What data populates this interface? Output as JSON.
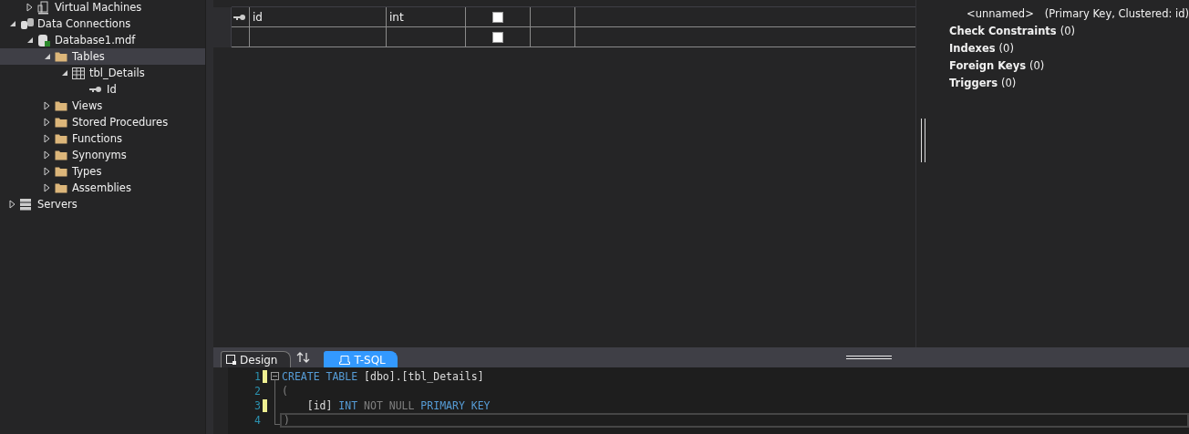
{
  "tree": {
    "scrolled_parent_children": [
      {
        "label": "Virtual Machines",
        "kind": "vm",
        "expanded": false,
        "selected": false
      }
    ],
    "nodes": [
      {
        "label": "Data Connections",
        "kind": "connections",
        "expanded": true,
        "selected": false,
        "children": [
          {
            "label": "Database1.mdf",
            "kind": "database",
            "expanded": true,
            "selected": false,
            "children": [
              {
                "label": "Tables",
                "kind": "folder",
                "expanded": true,
                "selected": true,
                "children": [
                  {
                    "label": "tbl_Details",
                    "kind": "table",
                    "expanded": true,
                    "selected": false,
                    "children": [
                      {
                        "label": "Id",
                        "kind": "key",
                        "selected": false
                      }
                    ]
                  }
                ]
              },
              {
                "label": "Views",
                "kind": "folder",
                "expanded": false,
                "selected": false
              },
              {
                "label": "Stored Procedures",
                "kind": "folder",
                "expanded": false,
                "selected": false
              },
              {
                "label": "Functions",
                "kind": "folder",
                "expanded": false,
                "selected": false
              },
              {
                "label": "Synonyms",
                "kind": "folder",
                "expanded": false,
                "selected": false
              },
              {
                "label": "Types",
                "kind": "folder",
                "expanded": false,
                "selected": false
              },
              {
                "label": "Assemblies",
                "kind": "folder",
                "expanded": false,
                "selected": false
              }
            ]
          }
        ]
      },
      {
        "label": "Servers",
        "kind": "server",
        "expanded": false,
        "selected": false
      }
    ]
  },
  "grid": {
    "rows": [
      {
        "primary_key": true,
        "name": "id",
        "type": "int",
        "allow_nulls": false
      },
      {
        "primary_key": false,
        "allow_nulls": false
      }
    ]
  },
  "properties": [
    {
      "kind": "key",
      "label": "<unnamed>",
      "detail": "(Primary Key, Clustered: id)"
    },
    {
      "kind": "group",
      "label": "Check Constraints",
      "detail": "(0)"
    },
    {
      "kind": "group",
      "label": "Indexes",
      "detail": "(0)"
    },
    {
      "kind": "group",
      "label": "Foreign Keys",
      "detail": "(0)"
    },
    {
      "kind": "group",
      "label": "Triggers",
      "detail": "(0)"
    }
  ],
  "tabs": [
    {
      "label": "Design",
      "kind": "design",
      "selected": false
    },
    {
      "label": "T-SQL",
      "kind": "tsql",
      "selected": true
    }
  ],
  "code": [
    {
      "number": "1",
      "changed": true,
      "current": false,
      "tokens": [
        {
          "kind": "keyword",
          "text": "CREATE TABLE "
        },
        {
          "kind": "plain",
          "text": "[dbo].[tbl_Details]"
        }
      ]
    },
    {
      "number": "2",
      "changed": false,
      "current": false,
      "tokens": [
        {
          "kind": "grey",
          "text": "("
        }
      ]
    },
    {
      "number": "3",
      "changed": true,
      "current": false,
      "tokens": [
        {
          "kind": "plain",
          "text": "    [id] "
        },
        {
          "kind": "keyword",
          "text": "INT "
        },
        {
          "kind": "grey",
          "text": "NOT NULL "
        },
        {
          "kind": "keyword",
          "text": "PRIMARY KEY"
        }
      ]
    },
    {
      "number": "4",
      "changed": false,
      "current": true,
      "tokens": [
        {
          "kind": "grey",
          "text": ")"
        }
      ]
    }
  ]
}
